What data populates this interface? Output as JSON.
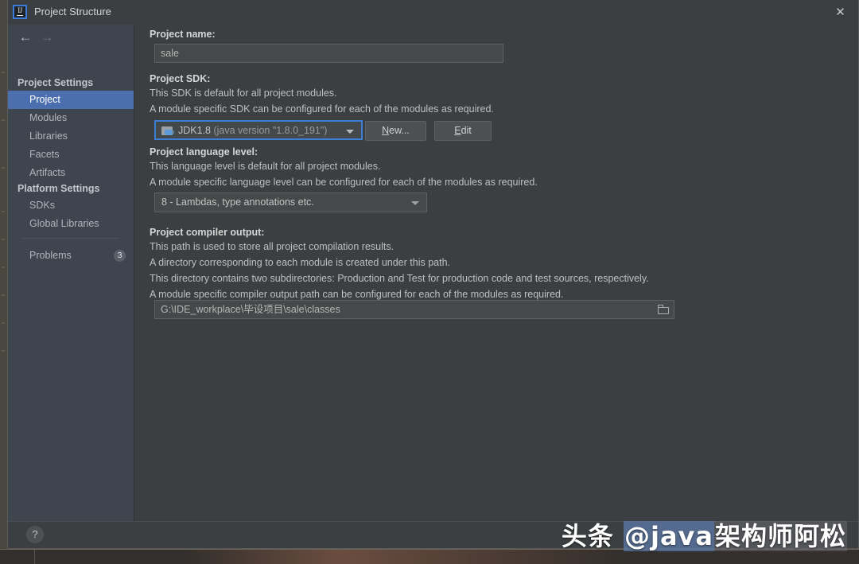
{
  "window": {
    "title": "Project Structure",
    "app_icon": "intellij-idea-icon",
    "close_label": "✕"
  },
  "nav": {
    "back": "←",
    "forward": "→"
  },
  "sidebar": {
    "groups": [
      {
        "label": "Project Settings"
      },
      {
        "label": "Platform Settings"
      }
    ],
    "items": [
      {
        "label": "Project",
        "selected": true
      },
      {
        "label": "Modules",
        "selected": false
      },
      {
        "label": "Libraries",
        "selected": false
      },
      {
        "label": "Facets",
        "selected": false
      },
      {
        "label": "Artifacts",
        "selected": false
      },
      {
        "label": "SDKs",
        "selected": false
      },
      {
        "label": "Global Libraries",
        "selected": false
      }
    ],
    "problems": {
      "label": "Problems",
      "count": "3"
    }
  },
  "main": {
    "project_name": {
      "label": "Project name:",
      "value": "sale"
    },
    "project_sdk": {
      "label": "Project SDK:",
      "desc1": "This SDK is default for all project modules.",
      "desc2": "A module specific SDK can be configured for each of the modules as required.",
      "selected_name": "JDK1.8",
      "selected_version": "(java version \"1.8.0_191\")",
      "icon": "jdk-folder-icon",
      "new_button": {
        "pre": "",
        "mnemonic": "N",
        "post": "ew..."
      },
      "edit_button": {
        "pre": "",
        "mnemonic": "E",
        "post": "dit"
      }
    },
    "language_level": {
      "label": "Project language level:",
      "desc1": "This language level is default for all project modules.",
      "desc2": "A module specific language level can be configured for each of the modules as required.",
      "value": "8 - Lambdas, type annotations etc."
    },
    "compiler_output": {
      "label": "Project compiler output:",
      "desc1": "This path is used to store all project compilation results.",
      "desc2": "A directory corresponding to each module is created under this path.",
      "desc3": "This directory contains two subdirectories: Production and Test for production code and test sources, respectively.",
      "desc4": "A module specific compiler output path can be configured for each of the modules as required.",
      "value": "G:\\IDE_workplace\\毕设项目\\sale\\classes",
      "browse_icon": "folder-browse-icon"
    }
  },
  "footer": {
    "help_label": "?"
  },
  "watermark": {
    "part1": "头条 ",
    "part2": "@java",
    "part3": "架构师阿松"
  },
  "colors": {
    "accent_selected": "#4b6eaf",
    "focus_ring": "#3d7dd4",
    "dialog_bg": "#3c3f41",
    "sidebar_bg": "#3f454e",
    "field_bg": "#45494a"
  }
}
